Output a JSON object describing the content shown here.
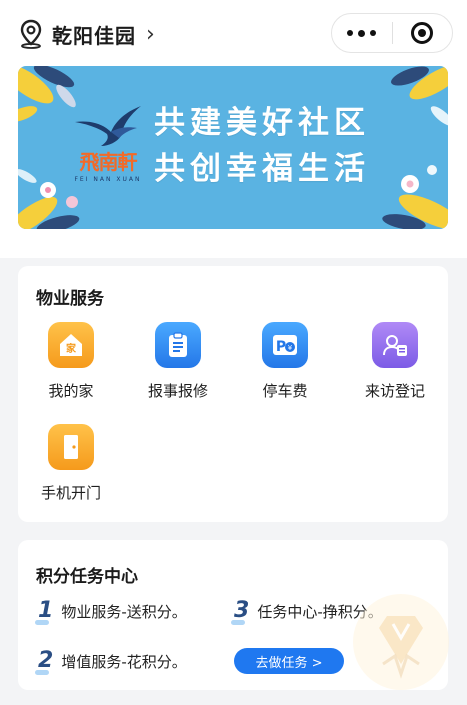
{
  "header": {
    "location_name": "乾阳佳园",
    "location_icon": "location-pin-icon",
    "chevron": "›"
  },
  "banner": {
    "brand_cn": "飛南軒",
    "brand_en": "FEI NAN XUAN",
    "slogan_line1": "共建美好社区",
    "slogan_line2": "共创幸福生活",
    "bg_color": "#5ab3e2"
  },
  "property_services": {
    "title": "物业服务",
    "items": [
      {
        "label": "我的家",
        "icon": "home-icon",
        "color": "orange"
      },
      {
        "label": "报事报修",
        "icon": "clipboard-icon",
        "color": "blue"
      },
      {
        "label": "停车费",
        "icon": "parking-fee-icon",
        "color": "blue"
      },
      {
        "label": "来访登记",
        "icon": "visitor-id-icon",
        "color": "purple"
      },
      {
        "label": "手机开门",
        "icon": "door-icon",
        "color": "orange"
      }
    ]
  },
  "task_center": {
    "title": "积分任务中心",
    "tasks": [
      {
        "num": "1",
        "text": "物业服务-送积分。"
      },
      {
        "num": "3",
        "text": "任务中心-挣积分。"
      },
      {
        "num": "2",
        "text": "增值服务-花积分。"
      }
    ],
    "go_button": "去做任务 >"
  },
  "colors": {
    "accent_blue": "#1f78f0",
    "brand_orange": "#f26a28"
  }
}
